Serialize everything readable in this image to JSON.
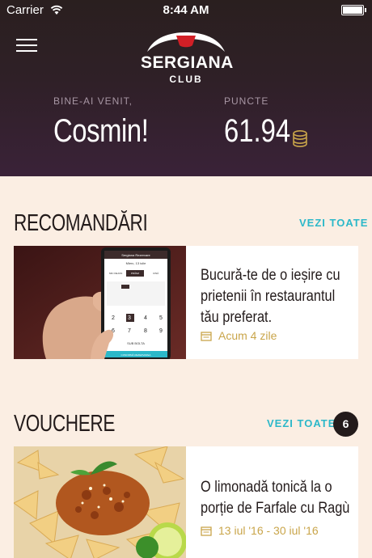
{
  "status_bar": {
    "carrier": "Carrier",
    "time": "8:44 AM"
  },
  "header": {
    "logo_brand": "SERGIANA",
    "logo_sub": "CLUB",
    "welcome_label": "BINE-AI VENIT,",
    "user_name": "Cosmin!",
    "points_label": "PUNCTE",
    "points_value": "61.94"
  },
  "recommendations": {
    "title": "RECOMANDĂRI",
    "see_all": "VEZI TOATE",
    "card": {
      "title": "Bucură-te de o ieșire cu prietenii în restaurantul tău preferat.",
      "meta": "Acum 4 zile",
      "phone_screen": {
        "app_title": "Sergiana Rezervare",
        "date": "Mierc, 13 iulie",
        "tabs": [
          "MIC DEJUN",
          "PRÂNZ",
          "CINĂ"
        ],
        "persons": [
          "2",
          "3",
          "4",
          "5",
          "6",
          "7",
          "8",
          "9"
        ],
        "action": "SUB BOLTA",
        "footer": "CONFIRMĂ REZERVAREA"
      }
    }
  },
  "vouchers": {
    "title": "VOUCHERE",
    "see_all": "VEZI TOATE",
    "count": "6",
    "card": {
      "title": "O limonadă tonică la o porție de Farfale cu Ragù",
      "meta": "13 iul '16 - 30 iul '16"
    }
  },
  "colors": {
    "accent": "#2cb8c9",
    "header_bg": "#2f2027",
    "page_bg": "#fbeee3",
    "meta_gold": "#c9a54a"
  }
}
